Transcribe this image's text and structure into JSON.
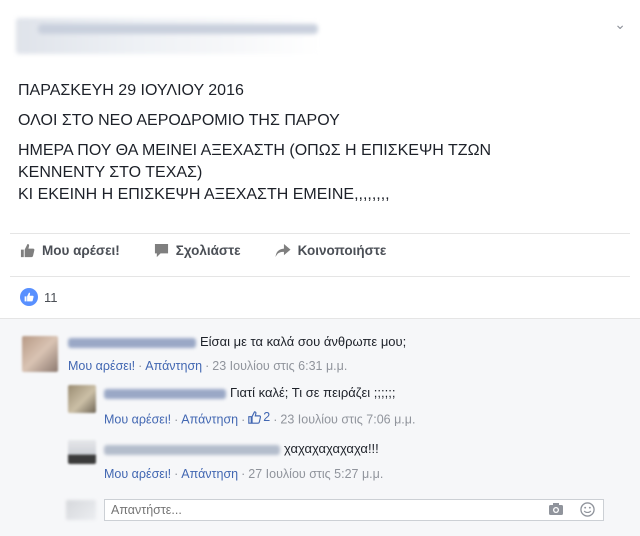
{
  "post": {
    "lines": [
      "ΠΑΡΑΣΚΕΥΗ 29 ΙΟΥΛΙΟΥ 2016",
      "ΟΛΟΙ ΣΤΟ ΝΕΟ ΑΕΡΟΔΡΟΜΙΟ ΤΗΣ ΠΑΡΟΥ",
      "ΗΜΕΡΑ ΠΟΥ ΘΑ ΜΕΙΝΕΙ ΑΞΕΧΑΣΤΗ (ΟΠΩΣ Η ΕΠΙΣΚΕΨΗ ΤΖΩΝ",
      "ΚΕΝΝΕΝΤΥ ΣΤΟ ΤΕΧΑΣ)",
      "ΚΙ ΕΚΕΙΝΗ Η ΕΠΙΣΚΕΨΗ ΑΞΕΧΑΣΤΗ ΕΜΕΙΝΕ,,,,,,,,"
    ]
  },
  "actions": {
    "like": "Μου αρέσει!",
    "comment": "Σχολιάστε",
    "share": "Κοινοποιήστε"
  },
  "likes_count": "11",
  "comments": [
    {
      "text": "Είσαι με τα καλά σου άνθρωπε μου;",
      "like": "Μου αρέσει!",
      "reply": "Απάντηση",
      "time": "23 Ιουλίου στις 6:31 μ.μ."
    },
    {
      "text": "Γιατί καλέ; Τι σε πειράζει ;;;;;;",
      "like": "Μου αρέσει!",
      "reply": "Απάντηση",
      "likes": "2",
      "time": "23 Ιουλίου στις 7:06 μ.μ."
    },
    {
      "text": "χαχαχαχαχαχα!!!",
      "like": "Μου αρέσει!",
      "reply": "Απάντηση",
      "time": "27 Ιουλίου στις 5:27 μ.μ."
    }
  ],
  "reply_placeholder": "Απαντήστε...",
  "colors": {
    "link": "#4267b2",
    "like_badge": "#5890ff"
  }
}
